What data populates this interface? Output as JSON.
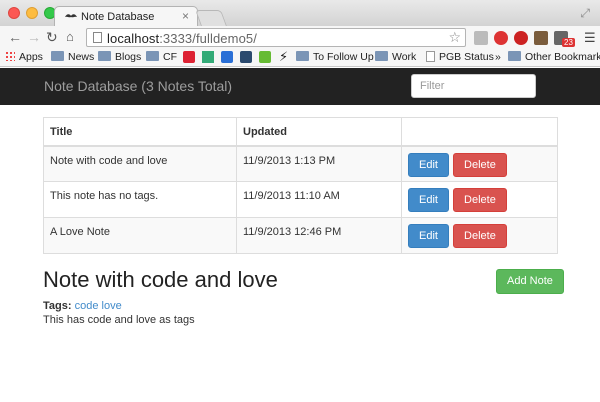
{
  "browser": {
    "tab_title": "Note Database",
    "url_host": "localhost",
    "url_rest": ":3333/fulldemo5/",
    "tab_close": "×",
    "bookmarks": [
      {
        "label": "Apps",
        "type": "apps"
      },
      {
        "label": "News",
        "type": "folder"
      },
      {
        "label": "Blogs",
        "type": "folder"
      },
      {
        "label": "CF",
        "type": "folder"
      },
      {
        "label": "To Follow Up",
        "type": "folder"
      },
      {
        "label": "Work",
        "type": "folder"
      },
      {
        "label": "PGB Status",
        "type": "doc"
      },
      {
        "label": "»",
        "type": "overflow"
      },
      {
        "label": "Other Bookmarks",
        "type": "folder"
      }
    ],
    "extension_badge": "23"
  },
  "app": {
    "brand": "Note Database (3 Notes Total)",
    "filter_placeholder": "Filter",
    "table": {
      "headers": [
        "Title",
        "Updated",
        ""
      ],
      "rows": [
        {
          "title": "Note with code and love",
          "updated": "11/9/2013 1:13 PM"
        },
        {
          "title": "This note has no tags.",
          "updated": "11/9/2013 11:10 AM"
        },
        {
          "title": "A Love Note",
          "updated": "11/9/2013 12:46 PM"
        }
      ],
      "edit_label": "Edit",
      "delete_label": "Delete"
    },
    "selected_note": {
      "title": "Note with code and love",
      "tags_label": "Tags:",
      "tags": [
        "code",
        "love"
      ],
      "body": "This has code and love as tags"
    },
    "add_note_label": "Add Note"
  },
  "colors": {
    "navbar": "#222222",
    "edit": "#428bca",
    "delete": "#d9534f",
    "add": "#5cb85c"
  }
}
